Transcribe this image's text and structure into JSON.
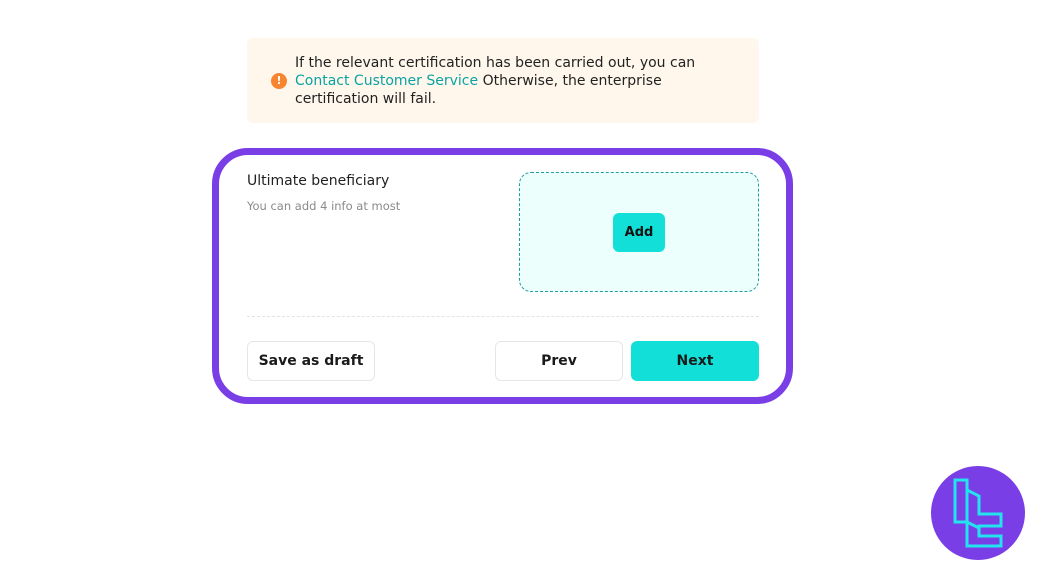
{
  "notice": {
    "icon": "exclamation-icon",
    "line1": "If the relevant certification has been carried out, you can",
    "link_text": "Contact Customer Service",
    "line2": " Otherwise, the enterprise certification will fail."
  },
  "beneficiary": {
    "title": "Ultimate beneficiary",
    "hint": "You can add 4 info at most",
    "add_label": "Add"
  },
  "footer": {
    "save_draft_label": "Save as draft",
    "prev_label": "Prev",
    "next_label": "Next"
  },
  "colors": {
    "accent": "#12e0d8",
    "highlight_outline": "#7a3ee6",
    "warning": "#f7842f",
    "link": "#0aa3a3"
  },
  "watermark": {
    "icon": "brand-logo-icon"
  }
}
